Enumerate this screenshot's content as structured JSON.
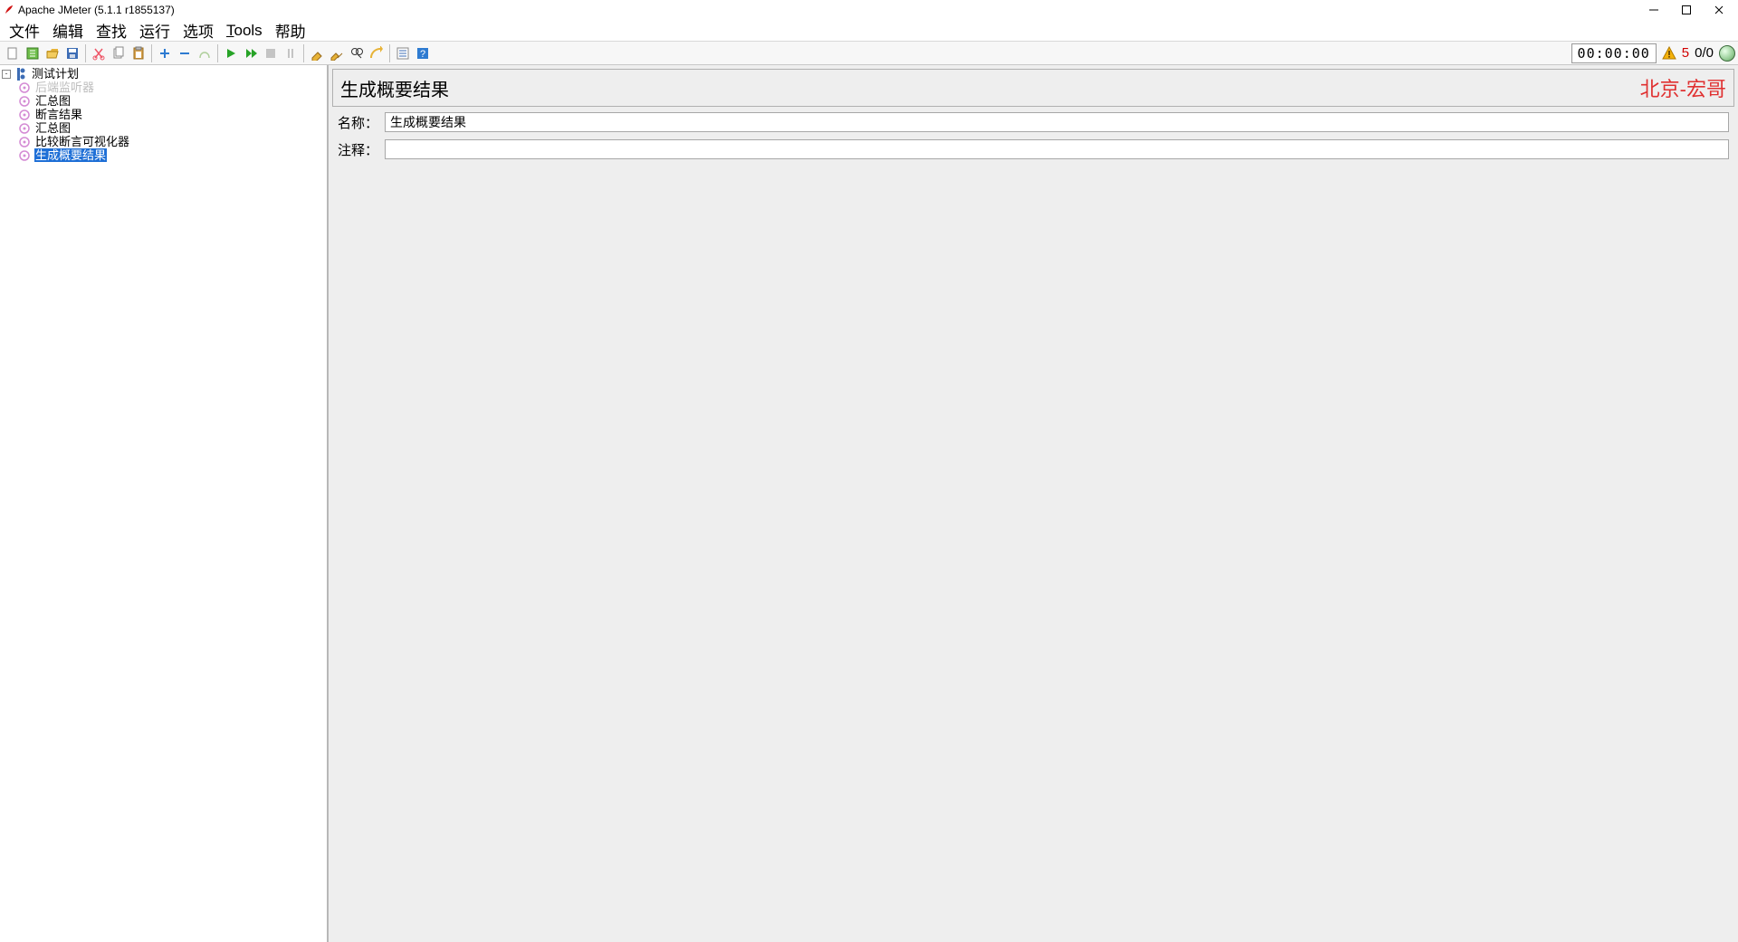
{
  "titlebar": {
    "title": "Apache JMeter (5.1.1 r1855137)"
  },
  "menus": {
    "file": "文件",
    "edit": "编辑",
    "search": "查找",
    "run": "运行",
    "options": "选项",
    "tools_raw": "Tools",
    "help": "帮助"
  },
  "toolbar": {
    "timer": "00:00:00",
    "error_count": "5",
    "thread_count": "0/0"
  },
  "tree": {
    "root": "测试计划",
    "children": [
      {
        "label": "后端监听器",
        "disabled": true
      },
      {
        "label": "汇总图",
        "disabled": false
      },
      {
        "label": "断言结果",
        "disabled": false
      },
      {
        "label": "汇总图",
        "disabled": false
      },
      {
        "label": "比较断言可视化器",
        "disabled": false
      },
      {
        "label": "生成概要结果",
        "disabled": false,
        "selected": true
      }
    ]
  },
  "panel": {
    "title": "生成概要结果",
    "watermark": "北京-宏哥",
    "name_label": "名称：",
    "name_value": "生成概要结果",
    "comment_label": "注释：",
    "comment_value": ""
  }
}
